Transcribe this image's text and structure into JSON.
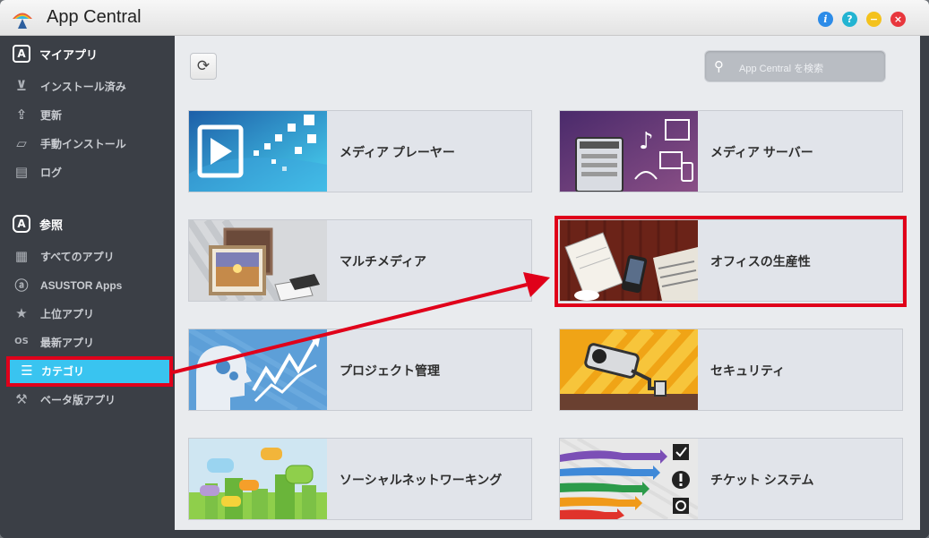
{
  "window": {
    "title": "App Central"
  },
  "controls": {
    "info": "i",
    "help": "?",
    "minimize": "−",
    "close": "×"
  },
  "sidebar": {
    "my_apps": {
      "title": "マイアプリ",
      "icon": "A",
      "items": [
        {
          "label": "インストール済み",
          "icon": "installed-icon",
          "glyph": "⊻"
        },
        {
          "label": "更新",
          "icon": "update-icon",
          "glyph": "⇪"
        },
        {
          "label": "手動インストール",
          "icon": "folder-icon",
          "glyph": "▱"
        },
        {
          "label": "ログ",
          "icon": "log-icon",
          "glyph": "▤"
        }
      ]
    },
    "browse": {
      "title": "参照",
      "icon": "A",
      "items": [
        {
          "label": "すべてのアプリ",
          "icon": "grid-icon",
          "glyph": "▦"
        },
        {
          "label": "ASUSTOR Apps",
          "icon": "asustor-icon",
          "glyph": "ⓐ"
        },
        {
          "label": "上位アプリ",
          "icon": "star-icon",
          "glyph": "★"
        },
        {
          "label": "最新アプリ",
          "icon": "os-icon",
          "glyph": "OS"
        },
        {
          "label": "カテゴリ",
          "icon": "list-icon",
          "glyph": "☰",
          "active": true
        },
        {
          "label": "ベータ版アプリ",
          "icon": "hammer-icon",
          "glyph": "⚒"
        }
      ]
    }
  },
  "toolbar": {
    "refresh_glyph": "⟳"
  },
  "search": {
    "placeholder": "App Central を検索",
    "glyph": "⚲"
  },
  "categories": [
    {
      "label": "メディア プレーヤー"
    },
    {
      "label": "メディア サーバー"
    },
    {
      "label": "マルチメディア"
    },
    {
      "label": "オフィスの生産性"
    },
    {
      "label": "プロジェクト管理"
    },
    {
      "label": "セキュリティ"
    },
    {
      "label": "ソーシャルネットワーキング"
    },
    {
      "label": "チケット システム"
    }
  ],
  "colors": {
    "accent": "#39c4f0",
    "highlight": "#e0001a",
    "sidebar": "#3b3f46"
  }
}
